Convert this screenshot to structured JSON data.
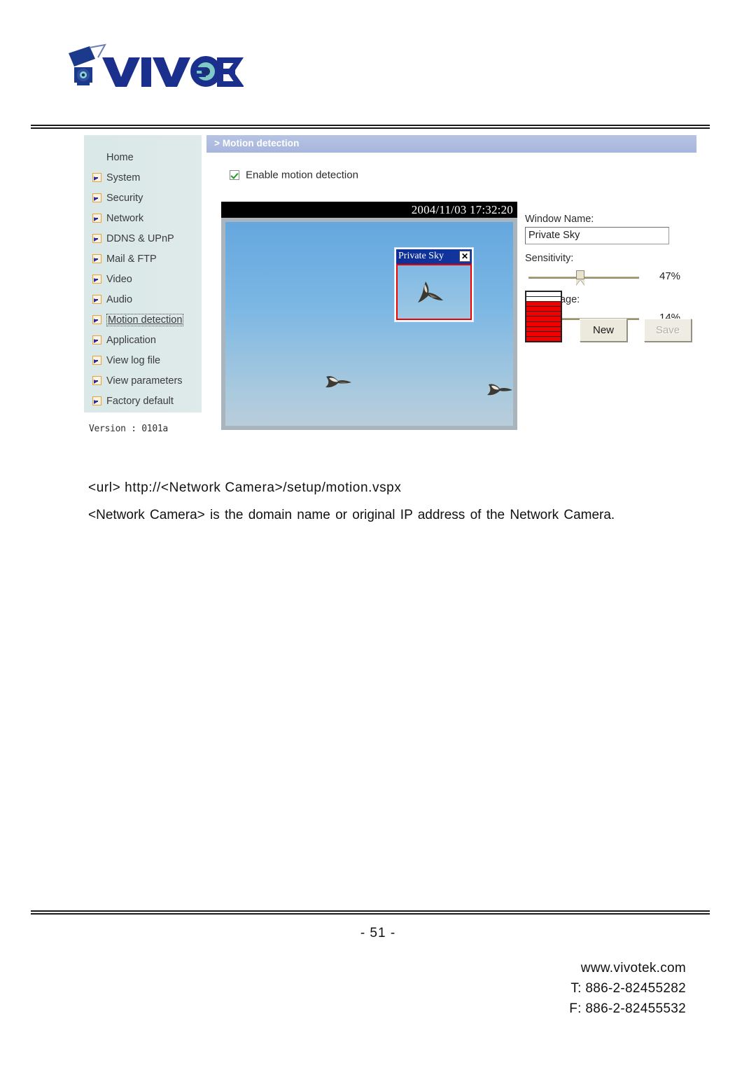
{
  "brand": {
    "logo_text": "VIVOTEK",
    "logo_icon": "camera-icon"
  },
  "sidebar": {
    "items": [
      {
        "label": "Home",
        "icon": null,
        "active": false
      },
      {
        "label": "System",
        "icon": "arrow-icon",
        "active": false
      },
      {
        "label": "Security",
        "icon": "arrow-icon",
        "active": false
      },
      {
        "label": "Network",
        "icon": "arrow-icon",
        "active": false
      },
      {
        "label": "DDNS & UPnP",
        "icon": "arrow-icon",
        "active": false
      },
      {
        "label": "Mail & FTP",
        "icon": "arrow-icon",
        "active": false
      },
      {
        "label": "Video",
        "icon": "arrow-icon",
        "active": false
      },
      {
        "label": "Audio",
        "icon": "arrow-icon",
        "active": false
      },
      {
        "label": "Motion detection",
        "icon": "arrow-icon",
        "active": true
      },
      {
        "label": "Application",
        "icon": "arrow-icon",
        "active": false
      },
      {
        "label": "View log file",
        "icon": "arrow-icon",
        "active": false
      },
      {
        "label": "View parameters",
        "icon": "arrow-icon",
        "active": false
      },
      {
        "label": "Factory default",
        "icon": "arrow-icon",
        "active": false
      }
    ],
    "version": "Version : 0101a"
  },
  "content": {
    "header_title": "> Motion detection",
    "enable_checkbox_label": "Enable motion detection",
    "enable_checkbox_checked": true
  },
  "video": {
    "timestamp": "2004/11/03 17:32:20",
    "detection_window": {
      "title": "Private Sky",
      "close_icon": "close-x-icon"
    }
  },
  "controls": {
    "window_name_label": "Window Name:",
    "window_name_value": "Private Sky",
    "window_name_placeholder": "Window Name",
    "sensitivity_label": "Sensitivity:",
    "sensitivity_value": "47%",
    "sensitivity_percent": 47,
    "percentage_label": "Percentage:",
    "percentage_value": "14%",
    "percentage_percent": 14,
    "new_button": "New",
    "save_button": "Save",
    "save_button_disabled": true,
    "meter_segments_total": 10,
    "meter_segments_filled": 8,
    "meter_fill_color": "#f20000"
  },
  "doc": {
    "url_line": "<url> http://<Network Camera>/setup/motion.vspx",
    "url_description": "<Network Camera> is the domain name or original IP address of the Network Camera.",
    "page_number": "- 51 -",
    "website": "www.vivotek.com",
    "telephone": "T: 886-2-82455282",
    "fax": "F: 886-2-82455532"
  },
  "colors": {
    "header_bar": "#aebcdf",
    "sidebar_bg": "#dce9e9",
    "accent_red": "#ee0000",
    "nav_icon_border": "#e8a33d",
    "nav_icon_arrow": "#2b2f9e",
    "checkbox_check": "#16a016"
  }
}
